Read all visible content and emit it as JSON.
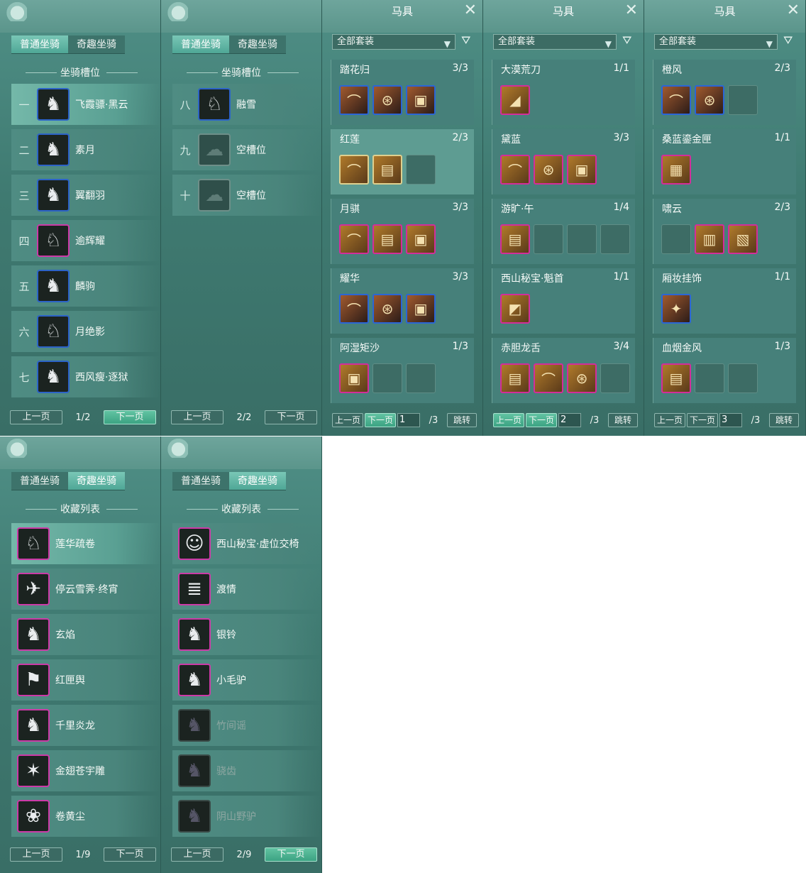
{
  "tabs": {
    "normal": "普通坐骑",
    "fun": "奇趣坐骑"
  },
  "titles": {
    "slots": "坐骑槽位",
    "collection": "收藏列表",
    "gear": "马具"
  },
  "buttons": {
    "prev": "上一页",
    "next": "下一页",
    "jump": "跳转"
  },
  "filter_label": "全部套装",
  "mount_panel_1": {
    "page": "1/2",
    "rows": [
      {
        "num": "一",
        "name": "飞霞骠·黑云"
      },
      {
        "num": "二",
        "name": "素月"
      },
      {
        "num": "三",
        "name": "翼翻羽"
      },
      {
        "num": "四",
        "name": "逾辉耀"
      },
      {
        "num": "五",
        "name": "麟驹"
      },
      {
        "num": "六",
        "name": "月绝影"
      },
      {
        "num": "七",
        "name": "西风瘦·逐狱"
      }
    ]
  },
  "mount_panel_2": {
    "page": "2/2",
    "rows": [
      {
        "num": "八",
        "name": "融雪"
      },
      {
        "num": "九",
        "name": "空槽位"
      },
      {
        "num": "十",
        "name": "空槽位"
      }
    ]
  },
  "gear_panel_1": {
    "page": "1",
    "total": "/3",
    "sets": [
      {
        "name": "踏花归",
        "count": "3/3"
      },
      {
        "name": "红莲",
        "count": "2/3"
      },
      {
        "name": "月骐",
        "count": "3/3"
      },
      {
        "name": "耀华",
        "count": "3/3"
      },
      {
        "name": "阿湿矩沙",
        "count": "1/3"
      }
    ]
  },
  "gear_panel_2": {
    "page": "2",
    "total": "/3",
    "sets": [
      {
        "name": "大漠荒刀",
        "count": "1/1"
      },
      {
        "name": "黛蓝",
        "count": "3/3"
      },
      {
        "name": "游旷·午",
        "count": "1/4"
      },
      {
        "name": "西山秘宝·魁首",
        "count": "1/1"
      },
      {
        "name": "赤胆龙舌",
        "count": "3/4"
      }
    ]
  },
  "gear_panel_3": {
    "page": "3",
    "total": "/3",
    "sets": [
      {
        "name": "橙风",
        "count": "2/3"
      },
      {
        "name": "桑蓝鎏金匣",
        "count": "1/1"
      },
      {
        "name": "啸云",
        "count": "2/3"
      },
      {
        "name": "厢妆挂饰",
        "count": "1/1"
      },
      {
        "name": "血烟金风",
        "count": "1/3"
      }
    ]
  },
  "collection_panel_1": {
    "page": "1/9",
    "rows": [
      "莲华疏卷",
      "停云雪霁·终宵",
      "玄焰",
      "红匣舆",
      "千里炎龙",
      "金翅苍宇雕",
      "卷黄尘"
    ]
  },
  "collection_panel_2": {
    "page": "2/9",
    "rows": [
      "西山秘宝·虚位交椅",
      "渡情",
      "银铃",
      "小毛驴",
      "竹间谣",
      "骁齿",
      "阴山野驴"
    ]
  }
}
